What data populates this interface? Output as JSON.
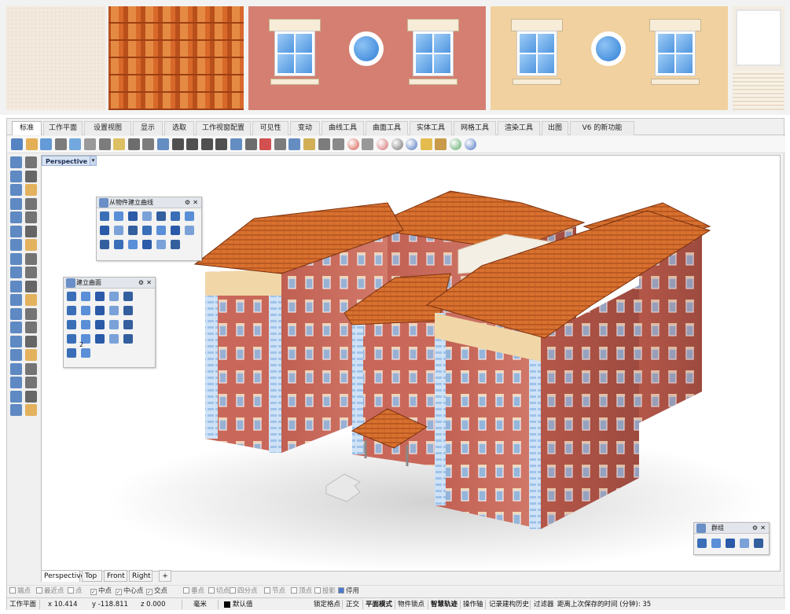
{
  "textures": [
    "plaster",
    "roof-tiles",
    "red-facade-windows",
    "beige-facade-windows",
    "window-with-blinds"
  ],
  "tabs": [
    "标准",
    "工作平面",
    "设置视图",
    "显示",
    "选取",
    "工作视窗配置",
    "可见性",
    "变动",
    "曲线工具",
    "曲面工具",
    "实体工具",
    "网格工具",
    "渲染工具",
    "出图",
    "V6 的新功能"
  ],
  "active_tab": "标准",
  "toolbar_icons": [
    "new-icon",
    "open-icon",
    "save-icon",
    "print-icon",
    "import-icon",
    "cut-icon",
    "copy-icon",
    "paste-icon",
    "undo-icon",
    "pan-icon",
    "rotate-view-icon",
    "zoom-icon",
    "zoom-window-icon",
    "zoom-extents-icon",
    "zoom-selected-icon",
    "undo-view-icon",
    "four-view-icon",
    "car-icon",
    "camera-icon",
    "named-view-icon",
    "layer-icon",
    "properties-icon",
    "lock-icon",
    "color-icon",
    "material-icon",
    "render-icon",
    "sphere-icon",
    "blue-sphere-icon",
    "brush-icon",
    "options-icon",
    "globe-icon",
    "help-icon"
  ],
  "viewport": {
    "label": "Perspective"
  },
  "panels": {
    "curve_from_object": {
      "title": "从物件建立曲线"
    },
    "create_surface": {
      "title": "建立曲面",
      "badge": "2"
    },
    "group": {
      "title": "群组"
    }
  },
  "view_tabs": [
    "Perspective",
    "Top",
    "Front",
    "Right"
  ],
  "view_tab_add": "+",
  "osnaps": [
    {
      "label": "端点",
      "checked": false
    },
    {
      "label": "最近点",
      "checked": false
    },
    {
      "label": "点",
      "checked": false
    },
    {
      "label": "中点",
      "checked": true
    },
    {
      "label": "中心点",
      "checked": true
    },
    {
      "label": "交点",
      "checked": true
    },
    {
      "label": "垂点",
      "checked": false
    },
    {
      "label": "切点",
      "checked": false
    },
    {
      "label": "四分点",
      "checked": false
    },
    {
      "label": "节点",
      "checked": false
    },
    {
      "label": "顶点",
      "checked": false
    },
    {
      "label": "投影",
      "checked": false
    },
    {
      "label": "停用",
      "checked": true
    }
  ],
  "status": {
    "plane": "工作平面",
    "x": "x 10.414",
    "y": "y -118.811",
    "z": "z 0.000",
    "units": "毫米",
    "layer": "默认值",
    "grid_snap": "锁定格点",
    "ortho": "正交",
    "planar": "平面模式",
    "osnap": "物件锁点",
    "smarttrack": "智慧轨迹",
    "gumball": "操作轴",
    "history": "记录建构历史",
    "filter": "过滤器",
    "autosave": "距离上次保存的时间 (分钟): 35"
  },
  "colors": {
    "accent": "#1a64c8",
    "roof": "#d8692a",
    "brick": "#c8675a",
    "beige": "#f1d19f"
  }
}
